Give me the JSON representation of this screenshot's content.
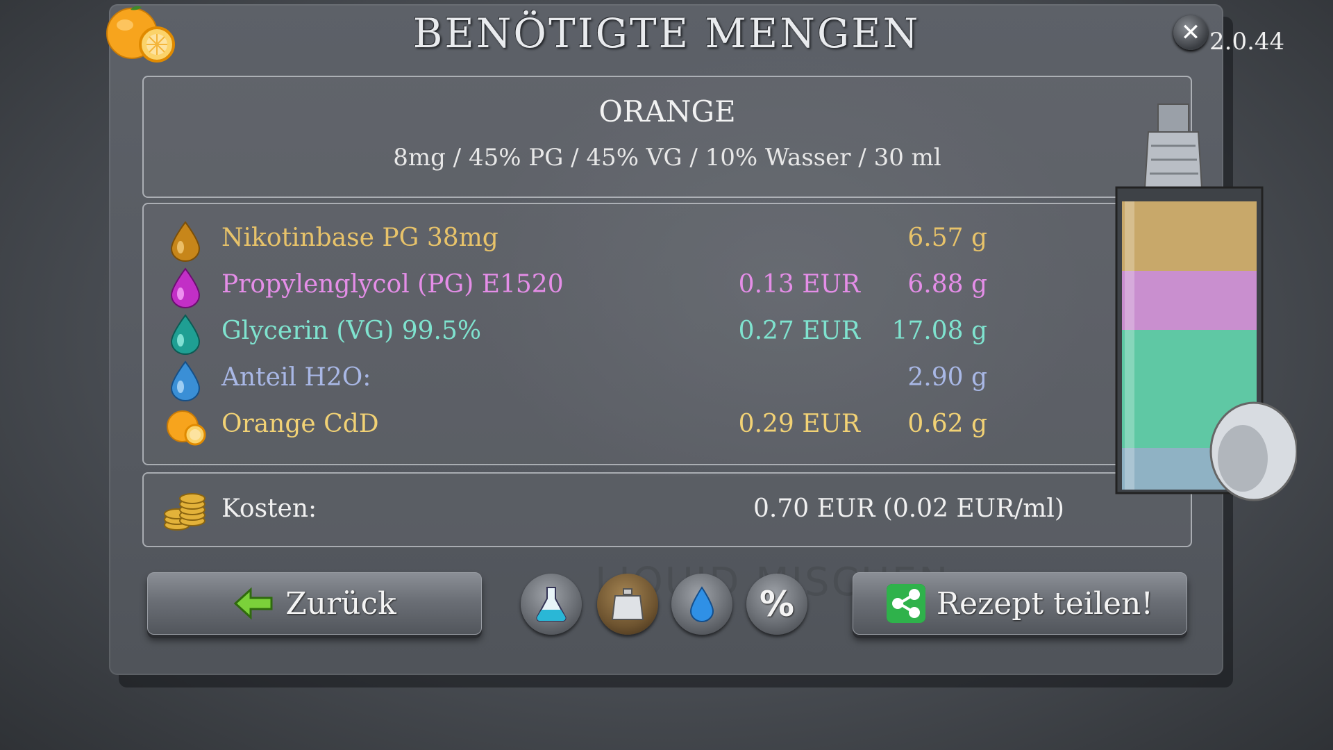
{
  "header": {
    "title": "BENÖTIGTE MENGEN",
    "version": "2.0.44",
    "close_icon": "close-icon"
  },
  "recipe": {
    "name": "ORANGE",
    "description": "8mg / 45% PG / 45% VG / 10% Wasser / 30 ml"
  },
  "ingredients": [
    {
      "name": "Nikotinbase PG 38mg",
      "price": "",
      "weight": "6.57 g",
      "color": "#e8c36a",
      "icon": "amber-drop-icon"
    },
    {
      "name": "Propylenglycol (PG) E1520",
      "price": "0.13 EUR",
      "weight": "6.88 g",
      "color": "#e58ee8",
      "icon": "magenta-drop-icon"
    },
    {
      "name": "Glycerin (VG) 99.5%",
      "price": "0.27 EUR",
      "weight": "17.08 g",
      "color": "#7fe3cf",
      "icon": "teal-drop-icon"
    },
    {
      "name": "Anteil H2O:",
      "price": "",
      "weight": "2.90 g",
      "color": "#a9b8e6",
      "icon": "blue-drop-icon"
    },
    {
      "name": "Orange CdD",
      "price": "0.29 EUR",
      "weight": "0.62 g",
      "color": "#f2d275",
      "icon": "orange-fruit-icon"
    }
  ],
  "cost": {
    "label": "Kosten:",
    "value": "0.70 EUR (0.02 EUR/ml)"
  },
  "buttons": {
    "back_label": "Zurück",
    "share_label": "Rezept teilen!",
    "mode_percent_label": "%"
  },
  "background_text": "LIQUID MISCHEN",
  "bottle_fill": {
    "layers": [
      {
        "name": "Nikotinbase",
        "color": "#c8a86a"
      },
      {
        "name": "PG",
        "color": "#c98fcf"
      },
      {
        "name": "VG",
        "color": "#5fc8a4"
      },
      {
        "name": "H2O",
        "color": "#8fb2c4"
      }
    ]
  }
}
